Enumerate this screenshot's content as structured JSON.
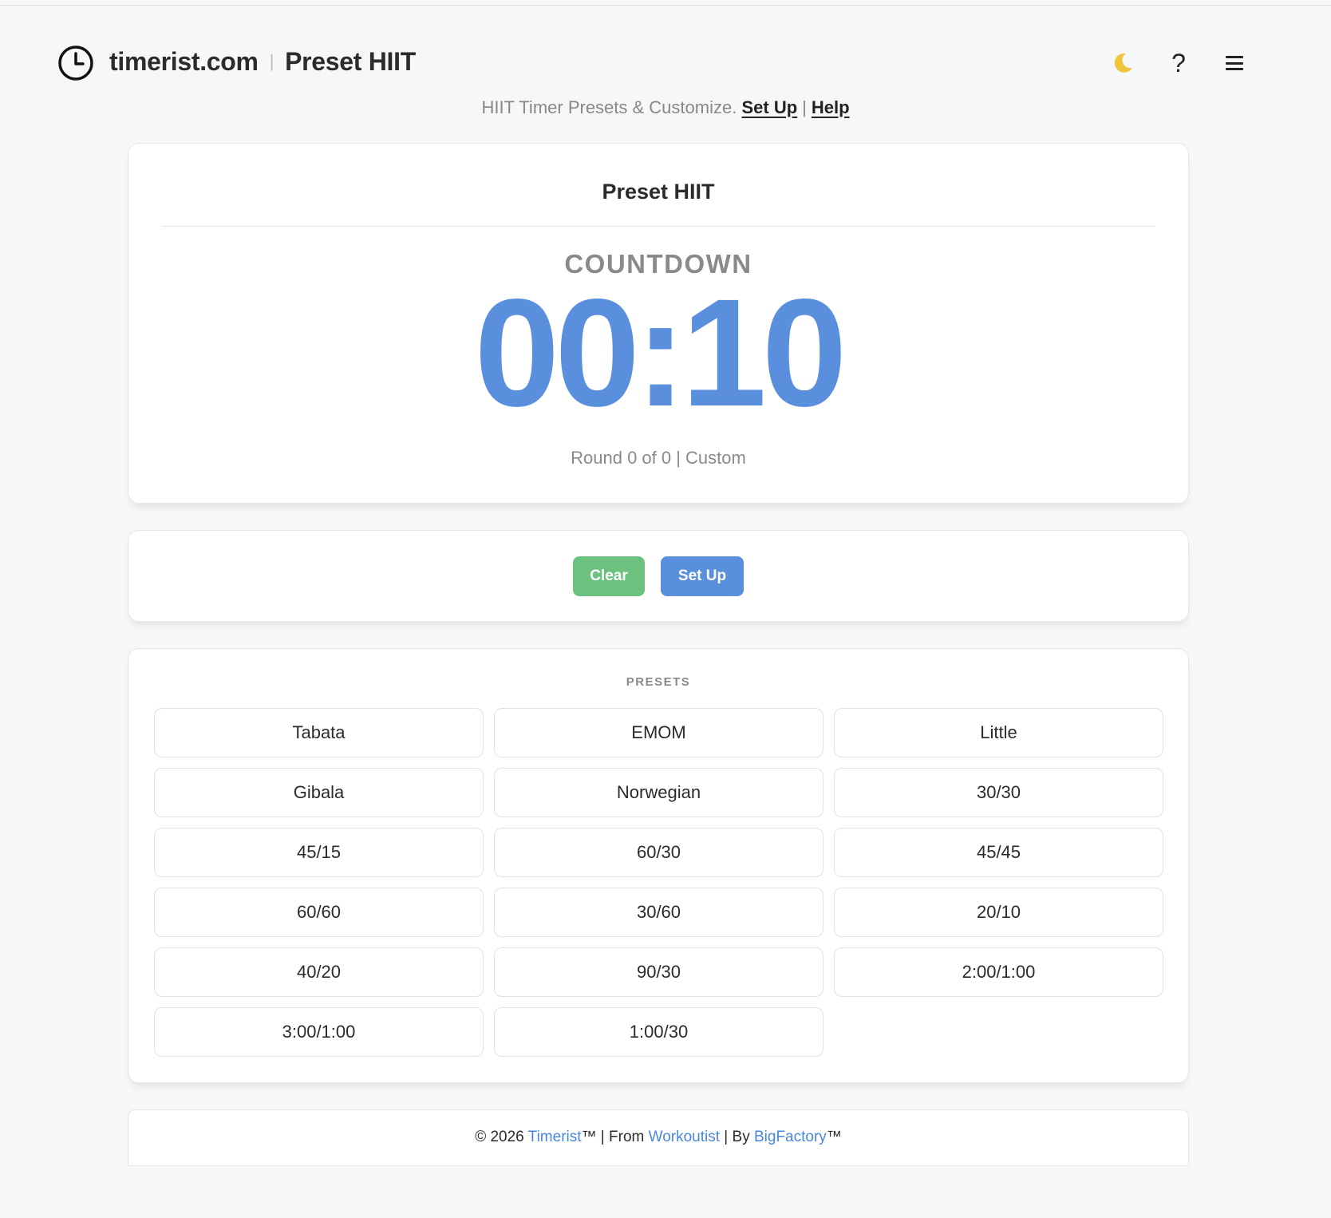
{
  "header": {
    "site": "timerist.com",
    "separator": "|",
    "page": "Preset HIIT",
    "actions": {
      "theme_icon": "moon-icon",
      "help_icon": "question-icon",
      "menu_icon": "hamburger-menu-icon",
      "help_glyph": "?"
    }
  },
  "subtitle": {
    "text": "HIIT Timer Presets & Customize.",
    "setup_link": "Set Up",
    "sep": "|",
    "help_link": "Help"
  },
  "timer": {
    "title": "Preset HIIT",
    "phase": "COUNTDOWN",
    "time": "00:10",
    "round_info": "Round 0 of 0 | Custom",
    "color": "#5a8fde"
  },
  "controls": {
    "clear_label": "Clear",
    "setup_label": "Set Up",
    "clear_color": "#6cc17f",
    "setup_color": "#5a8fde"
  },
  "presets": {
    "label": "PRESETS",
    "items": [
      "Tabata",
      "EMOM",
      "Little",
      "Gibala",
      "Norwegian",
      "30/30",
      "45/15",
      "60/30",
      "45/45",
      "60/60",
      "30/60",
      "20/10",
      "40/20",
      "90/30",
      "2:00/1:00",
      "3:00/1:00",
      "1:00/30"
    ]
  },
  "footer": {
    "prefix": "© 2026 ",
    "timerist": "Timerist",
    "mid1": "™ | From ",
    "workoutist": "Workoutist",
    "mid2": " | By ",
    "bigfactory": "BigFactory",
    "suffix": "™"
  }
}
